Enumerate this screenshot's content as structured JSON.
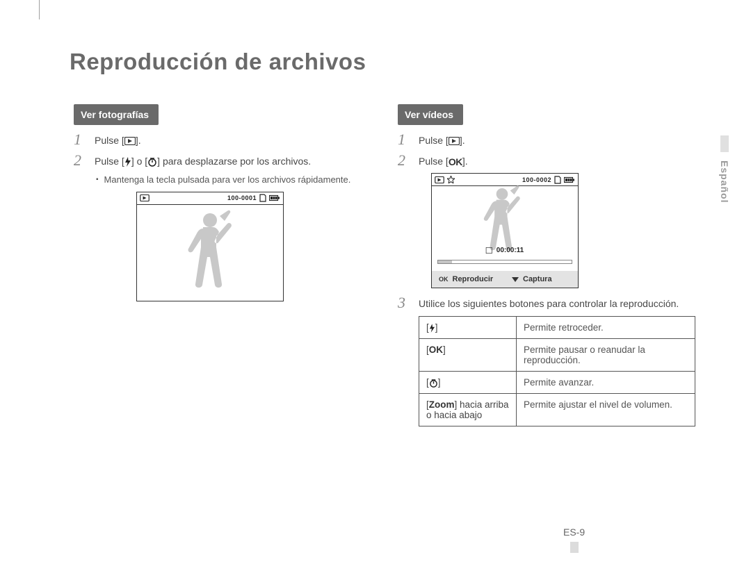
{
  "title": "Reproducción de archivos",
  "sideLang": "Español",
  "pageNumber": "ES-9",
  "left": {
    "section": "Ver fotografías",
    "steps": {
      "s1": {
        "pre": "Pulse [",
        "post": "]."
      },
      "s2": {
        "pre": "Pulse [",
        "mid": "] o [",
        "post": "] para desplazarse por los archivos."
      },
      "bullet": "Mantenga la tecla pulsada para ver los archivos rápidamente."
    },
    "screen": {
      "fileNumber": "100-0001"
    }
  },
  "right": {
    "section": "Ver vídeos",
    "steps": {
      "s1": {
        "pre": "Pulse [",
        "post": "]."
      },
      "s2": {
        "pre": "Pulse [",
        "post": "]."
      },
      "s3": "Utilice los siguientes botones para controlar la reproducción."
    },
    "screen": {
      "fileNumber": "100-0002",
      "time": "00:00:11",
      "footerLeft": "Reproducir",
      "footerRight": "Captura"
    },
    "controls": {
      "r1": {
        "desc": "Permite retroceder."
      },
      "r2": {
        "desc": "Permite pausar o reanudar la reproducción."
      },
      "r3": {
        "desc": "Permite avanzar."
      },
      "r4": {
        "keyPre": "[",
        "keyBold": "Zoom",
        "keyPost": "] hacia arriba o hacia abajo",
        "desc": "Permite ajustar el nivel de volumen."
      }
    }
  },
  "iconNames": {
    "playback": "playback-icon",
    "flash": "flash-icon",
    "timer": "timer-icon",
    "ok": "ok-icon",
    "battery": "battery-icon",
    "memcard": "memcard-icon",
    "star": "star-icon",
    "stop": "stop-icon",
    "down": "chevron-down-icon"
  }
}
